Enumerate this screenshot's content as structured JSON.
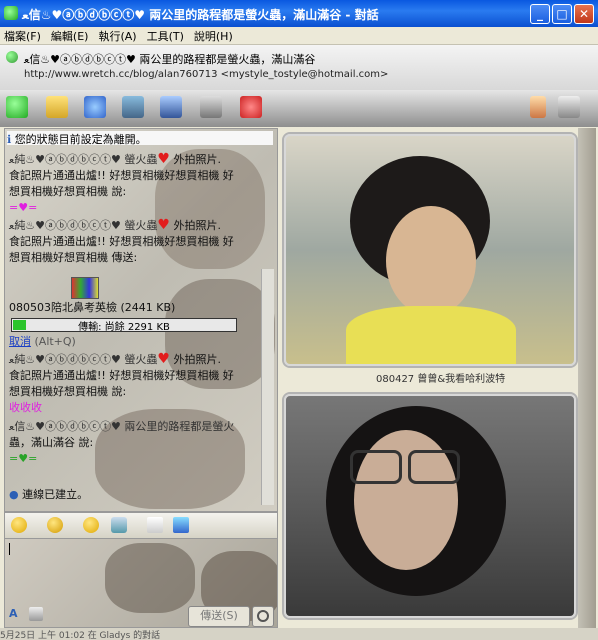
{
  "window": {
    "title": "ﻌ信♨♥ⓐⓑⓓⓑⓒⓣ♥ 兩公里的路程都是螢火蟲，滿山滿谷 - 對話",
    "minimize_glyph": "_",
    "maximize_glyph": "□",
    "close_glyph": "✕"
  },
  "menu": {
    "items": [
      "檔案(F)",
      "編輯(E)",
      "執行(A)",
      "工具(T)",
      "說明(H)"
    ]
  },
  "contact": {
    "name": "ﻌ信♨♥ⓐⓑⓓⓑⓒⓣ♥ 兩公里的路程都是螢火蟲，滿山滿谷",
    "info": "http://www.wretch.cc/blog/alan760713 <mystyle_tostyle@hotmail.com>"
  },
  "toolbar": {
    "icons": [
      "invite-icon",
      "send-files-icon",
      "webcam-icon",
      "call-icon",
      "activities-icon",
      "games-icon",
      "block-icon",
      "paintbrush-icon",
      "more-options-icon"
    ]
  },
  "chat": {
    "status_notice": "您的狀態目前設定為離開。",
    "messages": [
      {
        "nick": "ﻌ純♨♥ⓐⓑⓓⓑⓒⓣ♥ 螢火蟲",
        "text": "外拍照片.",
        "line2": "食記照片通通出爐!!   好想買相機好想買相機 好",
        "line3": "想買相機好想買相機 說:",
        "deco": "=♥="
      },
      {
        "nick": "ﻌ純♨♥ⓐⓑⓓⓑⓒⓣ♥ 螢火蟲",
        "text": "外拍照片.",
        "line2": "食記照片通通出爐!!   好想買相機好想買相機 好",
        "line3": "想買相機好想買相機 傳送:"
      },
      {
        "nick": "ﻌ純♨♥ⓐⓑⓓⓑⓒⓣ♥ 螢火蟲",
        "text": "外拍照片.",
        "line2": "食記照片通通出爐!!   好想買相機好想買相機 好",
        "line3": "想買相機好想買相機 說:",
        "deco": "收收收"
      },
      {
        "nick": "ﻌ信♨♥ⓐⓑⓓⓑⓒⓣ♥ 兩公里的路程都是螢火",
        "text": "",
        "line2": "蟲，滿山滿谷 說:",
        "line3": "",
        "deco": "=♥="
      }
    ],
    "file_name": "080503陪北鼻考英檢 (2441 KB)",
    "transfer_label": "傳輸: 尚餘 2291 KB",
    "transfer_progress": 0.06,
    "cancel_link": "取消",
    "cancel_hint": "(Alt+Q)",
    "connected": "連線已建立。"
  },
  "compose": {
    "send_label": "傳送(S)",
    "search_label": "搜尋"
  },
  "video": {
    "remote_caption": "080427 曾曾&我看哈利波特",
    "bottom_status": "5月25日 上午 01:02 在 Gladys 的對話"
  }
}
